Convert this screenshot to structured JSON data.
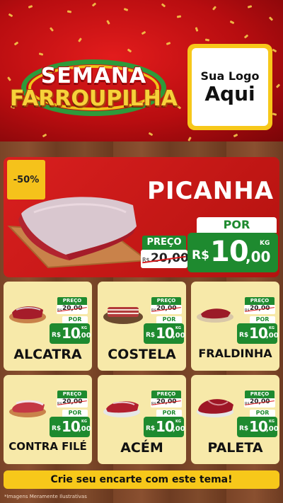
{
  "header": {
    "event_line1": "SEMANA",
    "event_line2": "FARROUPILHA",
    "logo_line1": "Sua Logo",
    "logo_line2": "Aqui"
  },
  "featured": {
    "discount": "-50%",
    "name": "PICANHA",
    "old_label": "PREÇO",
    "old_currency": "R$",
    "old_value": "20,00",
    "new_label": "POR",
    "currency": "R$",
    "price_int": "10",
    "price_dec": ",00",
    "unit": "KG"
  },
  "products": [
    {
      "name": "ALCATRA",
      "old_label": "PREÇO",
      "old_currency": "R$",
      "old_value": "20,00",
      "new_label": "POR",
      "currency": "R$",
      "price_int": "10",
      "price_dec": ",00",
      "unit": "KG"
    },
    {
      "name": "COSTELA",
      "old_label": "PREÇO",
      "old_currency": "R$",
      "old_value": "20,00",
      "new_label": "POR",
      "currency": "R$",
      "price_int": "10",
      "price_dec": ",00",
      "unit": "KG"
    },
    {
      "name": "FRALDINHA",
      "old_label": "PREÇO",
      "old_currency": "R$",
      "old_value": "20,00",
      "new_label": "POR",
      "currency": "R$",
      "price_int": "10",
      "price_dec": ",00",
      "unit": "KG"
    },
    {
      "name": "CONTRA FILÉ",
      "old_label": "PREÇO",
      "old_currency": "R$",
      "old_value": "20,00",
      "new_label": "POR",
      "currency": "R$",
      "price_int": "10",
      "price_dec": ",00",
      "unit": "KG"
    },
    {
      "name": "ACÉM",
      "old_label": "PREÇO",
      "old_currency": "R$",
      "old_value": "20,00",
      "new_label": "POR",
      "currency": "R$",
      "price_int": "10",
      "price_dec": ",00",
      "unit": "KG"
    },
    {
      "name": "PALETA",
      "old_label": "PREÇO",
      "old_currency": "R$",
      "old_value": "20,00",
      "new_label": "POR",
      "currency": "R$",
      "price_int": "10",
      "price_dec": ",00",
      "unit": "KG"
    }
  ],
  "cta": "Crie seu encarte com este tema!",
  "disclaimer": "*Imagens Meramente Ilustrativas",
  "colors": {
    "red": "#c4161a",
    "green": "#1e8a2f",
    "yellow": "#f7c81a",
    "card": "#f7e9a9"
  }
}
